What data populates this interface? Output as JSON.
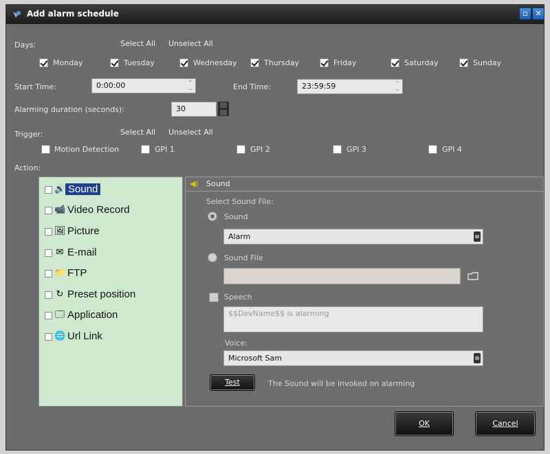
{
  "window": {
    "title": "Add alarm schedule"
  },
  "days": {
    "label": "Days:",
    "select_all": "Select All",
    "unselect_all": "Unselect All",
    "items": [
      {
        "label": "Monday",
        "checked": true
      },
      {
        "label": "Tuesday",
        "checked": true
      },
      {
        "label": "Wednesday",
        "checked": true
      },
      {
        "label": "Thursday",
        "checked": true
      },
      {
        "label": "Friday",
        "checked": true
      },
      {
        "label": "Saturday",
        "checked": true
      },
      {
        "label": "Sunday",
        "checked": true
      }
    ]
  },
  "time": {
    "start_label": "Start Time:",
    "start_value": "0:00:00",
    "end_label": "End Time:",
    "end_value": "23:59:59"
  },
  "duration": {
    "label": "Alarming duration (seconds):",
    "value": "30"
  },
  "trigger": {
    "label": "Trigger:",
    "select_all": "Select All",
    "unselect_all": "Unselect All",
    "items": [
      {
        "label": "Motion Detection",
        "checked": false
      },
      {
        "label": "GPI 1",
        "checked": false
      },
      {
        "label": "GPI 2",
        "checked": false
      },
      {
        "label": "GPI 3",
        "checked": false
      },
      {
        "label": "GPI 4",
        "checked": false
      }
    ]
  },
  "action": {
    "label": "Action:",
    "items": [
      {
        "label": "Sound",
        "icon": "speaker-icon",
        "selected": true
      },
      {
        "label": "Video Record",
        "icon": "camera-icon",
        "selected": false
      },
      {
        "label": "Picture",
        "icon": "picture-icon",
        "selected": false
      },
      {
        "label": "E-mail",
        "icon": "envelope-icon",
        "selected": false
      },
      {
        "label": "FTP",
        "icon": "ftp-icon",
        "selected": false
      },
      {
        "label": "Preset position",
        "icon": "preset-icon",
        "selected": false
      },
      {
        "label": "Application",
        "icon": "application-icon",
        "selected": false
      },
      {
        "label": "Url Link",
        "icon": "globe-icon",
        "selected": false
      }
    ]
  },
  "sound_panel": {
    "header": "Sound",
    "select_label": "Select Sound File:",
    "radio_sound": "Sound",
    "sound_value": "Alarm",
    "radio_file": "Sound File",
    "file_value": "",
    "speech_label": "Speech",
    "speech_text": "$$DevName$$ is alarming",
    "voice_label": "Voice:",
    "voice_value": "Microsoft Sam",
    "test_button": "Test",
    "test_note": "The Sound will be invoked on alarming"
  },
  "buttons": {
    "ok": "OK",
    "cancel": "Cancel"
  }
}
